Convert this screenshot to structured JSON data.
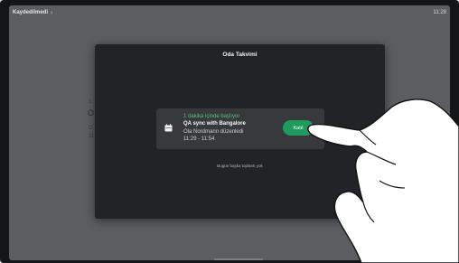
{
  "topbar": {
    "left_label": "Kaydedilmedi",
    "chevron": "›",
    "time": "11:28"
  },
  "background": {
    "fragments": [
      "1.",
      "O",
      "O",
      "11"
    ]
  },
  "modal": {
    "title": "Oda Takvimi",
    "meeting": {
      "status": "1 dakika içinde başlıyor",
      "title": "QA sync with Bangalore",
      "organizer": "Ola Nordmann düzenledi",
      "time_range": "11:29 - 11:54",
      "icon": "calendar-icon",
      "join_label": "Katıl"
    },
    "no_more_meetings": "Bugün başka toplantı yok"
  },
  "colors": {
    "accent_green": "#1f9b5e",
    "status_green": "#52c47a",
    "modal_bg": "#222326",
    "card_bg": "#38393c",
    "screen_bg": "#5b5d61"
  }
}
